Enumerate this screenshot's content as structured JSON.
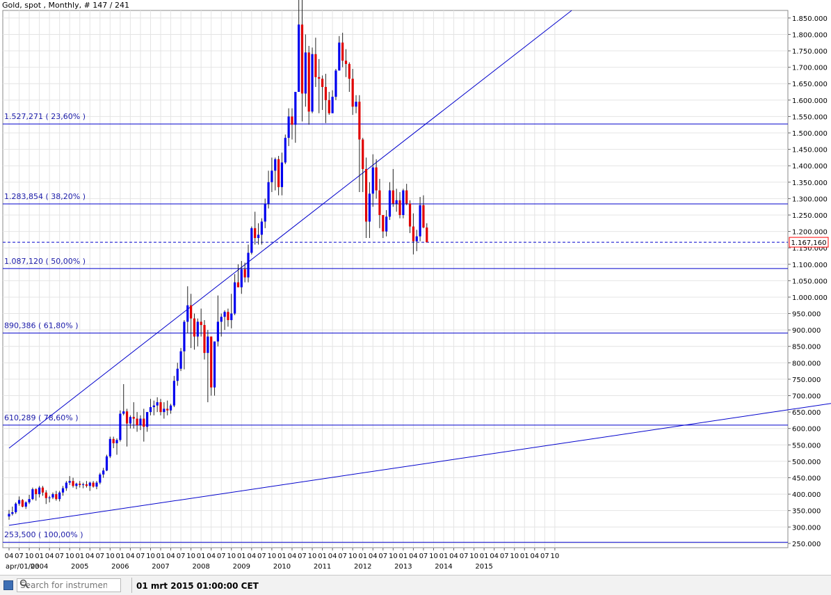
{
  "header": {
    "title": "Gold, spot , Monthly, # 147 / 241"
  },
  "price_marker": {
    "label": "1.167,160",
    "value": 1167.16,
    "color": "#ff0000"
  },
  "footer": {
    "search_placeholder": "Search for instrument",
    "timestamp": "01 mrt 2015 01:00:00 CET"
  },
  "colors": {
    "up": "#0000ee",
    "down": "#e00000",
    "lines": "#0000cc",
    "grid": "#e4e4e4"
  },
  "chart_data": {
    "type": "candlestick",
    "title": "Gold, spot , Monthly, # 147 / 241",
    "ylim": [
      237000,
      1873000
    ],
    "ytick_values": [
      250000,
      300000,
      350000,
      400000,
      450000,
      500000,
      550000,
      600000,
      650000,
      700000,
      750000,
      800000,
      850000,
      900000,
      950000,
      1000000,
      1050000,
      1100000,
      1150000,
      1200000,
      1250000,
      1300000,
      1350000,
      1400000,
      1450000,
      1500000,
      1550000,
      1600000,
      1650000,
      1700000,
      1750000,
      1800000,
      1850000
    ],
    "ytick_labels": [
      "250.000",
      "300.000",
      "350.000",
      "400.000",
      "450.000",
      "500.000",
      "550.000",
      "600.000",
      "650.000",
      "700.000",
      "750.000",
      "800.000",
      "850.000",
      "900.000",
      "950.000",
      "1.000.000",
      "1.050.000",
      "1.100.000",
      "1.150.000",
      "1.200.000",
      "1.250.000",
      "1.300.000",
      "1.350.000",
      "1.400.000",
      "1.450.000",
      "1.500.000",
      "1.550.000",
      "1.600.000",
      "1.650.000",
      "1.700.000",
      "1.750.000",
      "1.800.000",
      "1.850.000"
    ],
    "x_start_label": "apr/01/03",
    "x_month_labels": [
      "04",
      "07",
      "10",
      "01",
      "04",
      "07",
      "10",
      "01",
      "04",
      "07",
      "10",
      "01",
      "04",
      "07",
      "10",
      "01",
      "04",
      "07",
      "10",
      "01",
      "04",
      "07",
      "10",
      "01",
      "04",
      "07",
      "10",
      "01",
      "04",
      "07",
      "10",
      "01",
      "04",
      "07",
      "10",
      "01",
      "04",
      "07",
      "10",
      "01",
      "04",
      "07",
      "10",
      "01",
      "04",
      "07",
      "10",
      "01",
      "04",
      "07",
      "10",
      "01",
      "04",
      "07",
      "10"
    ],
    "x_year_labels": [
      "2004",
      "2005",
      "2006",
      "2007",
      "2008",
      "2009",
      "2010",
      "2011",
      "2012",
      "2013",
      "2014",
      "2015"
    ],
    "fib_levels": [
      {
        "label": "1.527,271  ( 23,60% )",
        "value": 1527271
      },
      {
        "label": "1.283,854  ( 38,20% )",
        "value": 1283854
      },
      {
        "label": "1.087,120  ( 50,00% )",
        "value": 1087120
      },
      {
        "label": "890,386  ( 61,80% )",
        "value": 890386
      },
      {
        "label": "610,289  ( 78,60% )",
        "value": 610289
      },
      {
        "label": "253,500  ( 100,00% )",
        "value": 253500
      }
    ],
    "trendlines": [
      {
        "name": "",
        "from": [
          0,
          540000
        ],
        "to": [
          167,
          1873000
        ]
      },
      {
        "name": "",
        "from": [
          0,
          305000
        ],
        "to": [
          255,
          693000
        ]
      }
    ],
    "current_price": 1167160,
    "ohlc": [
      [
        332,
        352,
        322,
        340
      ],
      [
        340,
        362,
        335,
        345
      ],
      [
        345,
        375,
        340,
        371
      ],
      [
        371,
        393,
        365,
        382
      ],
      [
        382,
        385,
        360,
        362
      ],
      [
        362,
        378,
        355,
        375
      ],
      [
        375,
        398,
        370,
        385
      ],
      [
        385,
        420,
        382,
        415
      ],
      [
        415,
        418,
        380,
        400
      ],
      [
        400,
        425,
        390,
        420
      ],
      [
        420,
        425,
        395,
        405
      ],
      [
        405,
        412,
        370,
        388
      ],
      [
        388,
        395,
        375,
        390
      ],
      [
        390,
        405,
        385,
        400
      ],
      [
        400,
        410,
        380,
        385
      ],
      [
        385,
        410,
        378,
        405
      ],
      [
        405,
        425,
        395,
        418
      ],
      [
        418,
        440,
        410,
        435
      ],
      [
        435,
        455,
        428,
        440
      ],
      [
        440,
        450,
        420,
        425
      ],
      [
        425,
        435,
        415,
        432
      ],
      [
        432,
        440,
        420,
        428
      ],
      [
        428,
        435,
        418,
        430
      ],
      [
        430,
        440,
        420,
        425
      ],
      [
        425,
        438,
        410,
        435
      ],
      [
        435,
        440,
        420,
        423
      ],
      [
        423,
        440,
        415,
        435
      ],
      [
        435,
        465,
        430,
        460
      ],
      [
        460,
        480,
        450,
        472
      ],
      [
        472,
        520,
        470,
        515
      ],
      [
        515,
        575,
        510,
        568
      ],
      [
        568,
        575,
        540,
        555
      ],
      [
        555,
        570,
        520,
        565
      ],
      [
        565,
        655,
        560,
        645
      ],
      [
        645,
        735,
        640,
        652
      ],
      [
        652,
        660,
        545,
        615
      ],
      [
        615,
        640,
        600,
        635
      ],
      [
        635,
        680,
        600,
        630
      ],
      [
        630,
        650,
        590,
        610
      ],
      [
        610,
        640,
        595,
        630
      ],
      [
        630,
        660,
        560,
        605
      ],
      [
        605,
        650,
        590,
        650
      ],
      [
        650,
        690,
        640,
        665
      ],
      [
        665,
        685,
        640,
        670
      ],
      [
        670,
        695,
        650,
        680
      ],
      [
        680,
        690,
        640,
        650
      ],
      [
        650,
        680,
        630,
        660
      ],
      [
        660,
        685,
        640,
        655
      ],
      [
        655,
        675,
        645,
        670
      ],
      [
        670,
        760,
        665,
        745
      ],
      [
        745,
        800,
        730,
        782
      ],
      [
        782,
        845,
        775,
        835
      ],
      [
        835,
        930,
        780,
        925
      ],
      [
        925,
        1033,
        890,
        975
      ],
      [
        975,
        1010,
        845,
        935
      ],
      [
        935,
        950,
        840,
        880
      ],
      [
        880,
        935,
        850,
        925
      ],
      [
        925,
        965,
        880,
        915
      ],
      [
        915,
        930,
        810,
        830
      ],
      [
        830,
        900,
        680,
        880
      ],
      [
        880,
        880,
        700,
        725
      ],
      [
        725,
        830,
        700,
        865
      ],
      [
        865,
        1005,
        850,
        925
      ],
      [
        925,
        950,
        880,
        940
      ],
      [
        940,
        960,
        900,
        955
      ],
      [
        955,
        965,
        910,
        930
      ],
      [
        930,
        1010,
        905,
        950
      ],
      [
        950,
        1070,
        945,
        1045
      ],
      [
        1045,
        1100,
        1030,
        1030
      ],
      [
        1030,
        1110,
        1010,
        1085
      ],
      [
        1085,
        1105,
        1045,
        1060
      ],
      [
        1060,
        1160,
        1045,
        1135
      ],
      [
        1135,
        1215,
        1130,
        1210
      ],
      [
        1210,
        1260,
        1160,
        1180
      ],
      [
        1180,
        1225,
        1160,
        1190
      ],
      [
        1190,
        1240,
        1160,
        1230
      ],
      [
        1230,
        1300,
        1210,
        1285
      ],
      [
        1285,
        1385,
        1270,
        1350
      ],
      [
        1350,
        1425,
        1320,
        1385
      ],
      [
        1385,
        1425,
        1325,
        1420
      ],
      [
        1420,
        1430,
        1310,
        1335
      ],
      [
        1335,
        1440,
        1310,
        1410
      ],
      [
        1410,
        1495,
        1405,
        1485
      ],
      [
        1485,
        1575,
        1460,
        1550
      ],
      [
        1550,
        1575,
        1480,
        1525
      ],
      [
        1525,
        1625,
        1470,
        1625
      ],
      [
        1625,
        1920,
        1625,
        1830
      ],
      [
        1830,
        1915,
        1535,
        1620
      ],
      [
        1620,
        1800,
        1580,
        1745
      ],
      [
        1745,
        1765,
        1525,
        1565
      ],
      [
        1565,
        1760,
        1560,
        1740
      ],
      [
        1740,
        1790,
        1640,
        1670
      ],
      [
        1670,
        1725,
        1560,
        1665
      ],
      [
        1665,
        1675,
        1570,
        1640
      ],
      [
        1640,
        1680,
        1530,
        1600
      ],
      [
        1600,
        1625,
        1555,
        1560
      ],
      [
        1560,
        1630,
        1570,
        1610
      ],
      [
        1610,
        1695,
        1600,
        1690
      ],
      [
        1690,
        1795,
        1690,
        1775
      ],
      [
        1775,
        1805,
        1700,
        1720
      ],
      [
        1720,
        1755,
        1670,
        1710
      ],
      [
        1710,
        1715,
        1625,
        1665
      ],
      [
        1665,
        1695,
        1555,
        1580
      ],
      [
        1580,
        1615,
        1560,
        1595
      ],
      [
        1595,
        1615,
        1320,
        1480
      ],
      [
        1480,
        1485,
        1320,
        1390
      ],
      [
        1390,
        1425,
        1180,
        1230
      ],
      [
        1230,
        1350,
        1180,
        1315
      ],
      [
        1315,
        1435,
        1275,
        1395
      ],
      [
        1395,
        1420,
        1300,
        1325
      ],
      [
        1325,
        1360,
        1210,
        1250
      ],
      [
        1250,
        1250,
        1180,
        1200
      ],
      [
        1200,
        1265,
        1185,
        1245
      ],
      [
        1245,
        1350,
        1235,
        1325
      ],
      [
        1325,
        1390,
        1275,
        1285
      ],
      [
        1285,
        1330,
        1260,
        1295
      ],
      [
        1295,
        1320,
        1240,
        1250
      ],
      [
        1250,
        1330,
        1240,
        1325
      ],
      [
        1325,
        1345,
        1280,
        1285
      ],
      [
        1285,
        1295,
        1195,
        1215
      ],
      [
        1215,
        1255,
        1130,
        1170
      ],
      [
        1170,
        1205,
        1140,
        1185
      ],
      [
        1185,
        1305,
        1170,
        1280
      ],
      [
        1280,
        1310,
        1210,
        1212
      ],
      [
        1212,
        1225,
        1170,
        1167
      ]
    ],
    "ohlc_note": "values in USD (open, high, low, close) per monthly bar starting apr 2003"
  }
}
